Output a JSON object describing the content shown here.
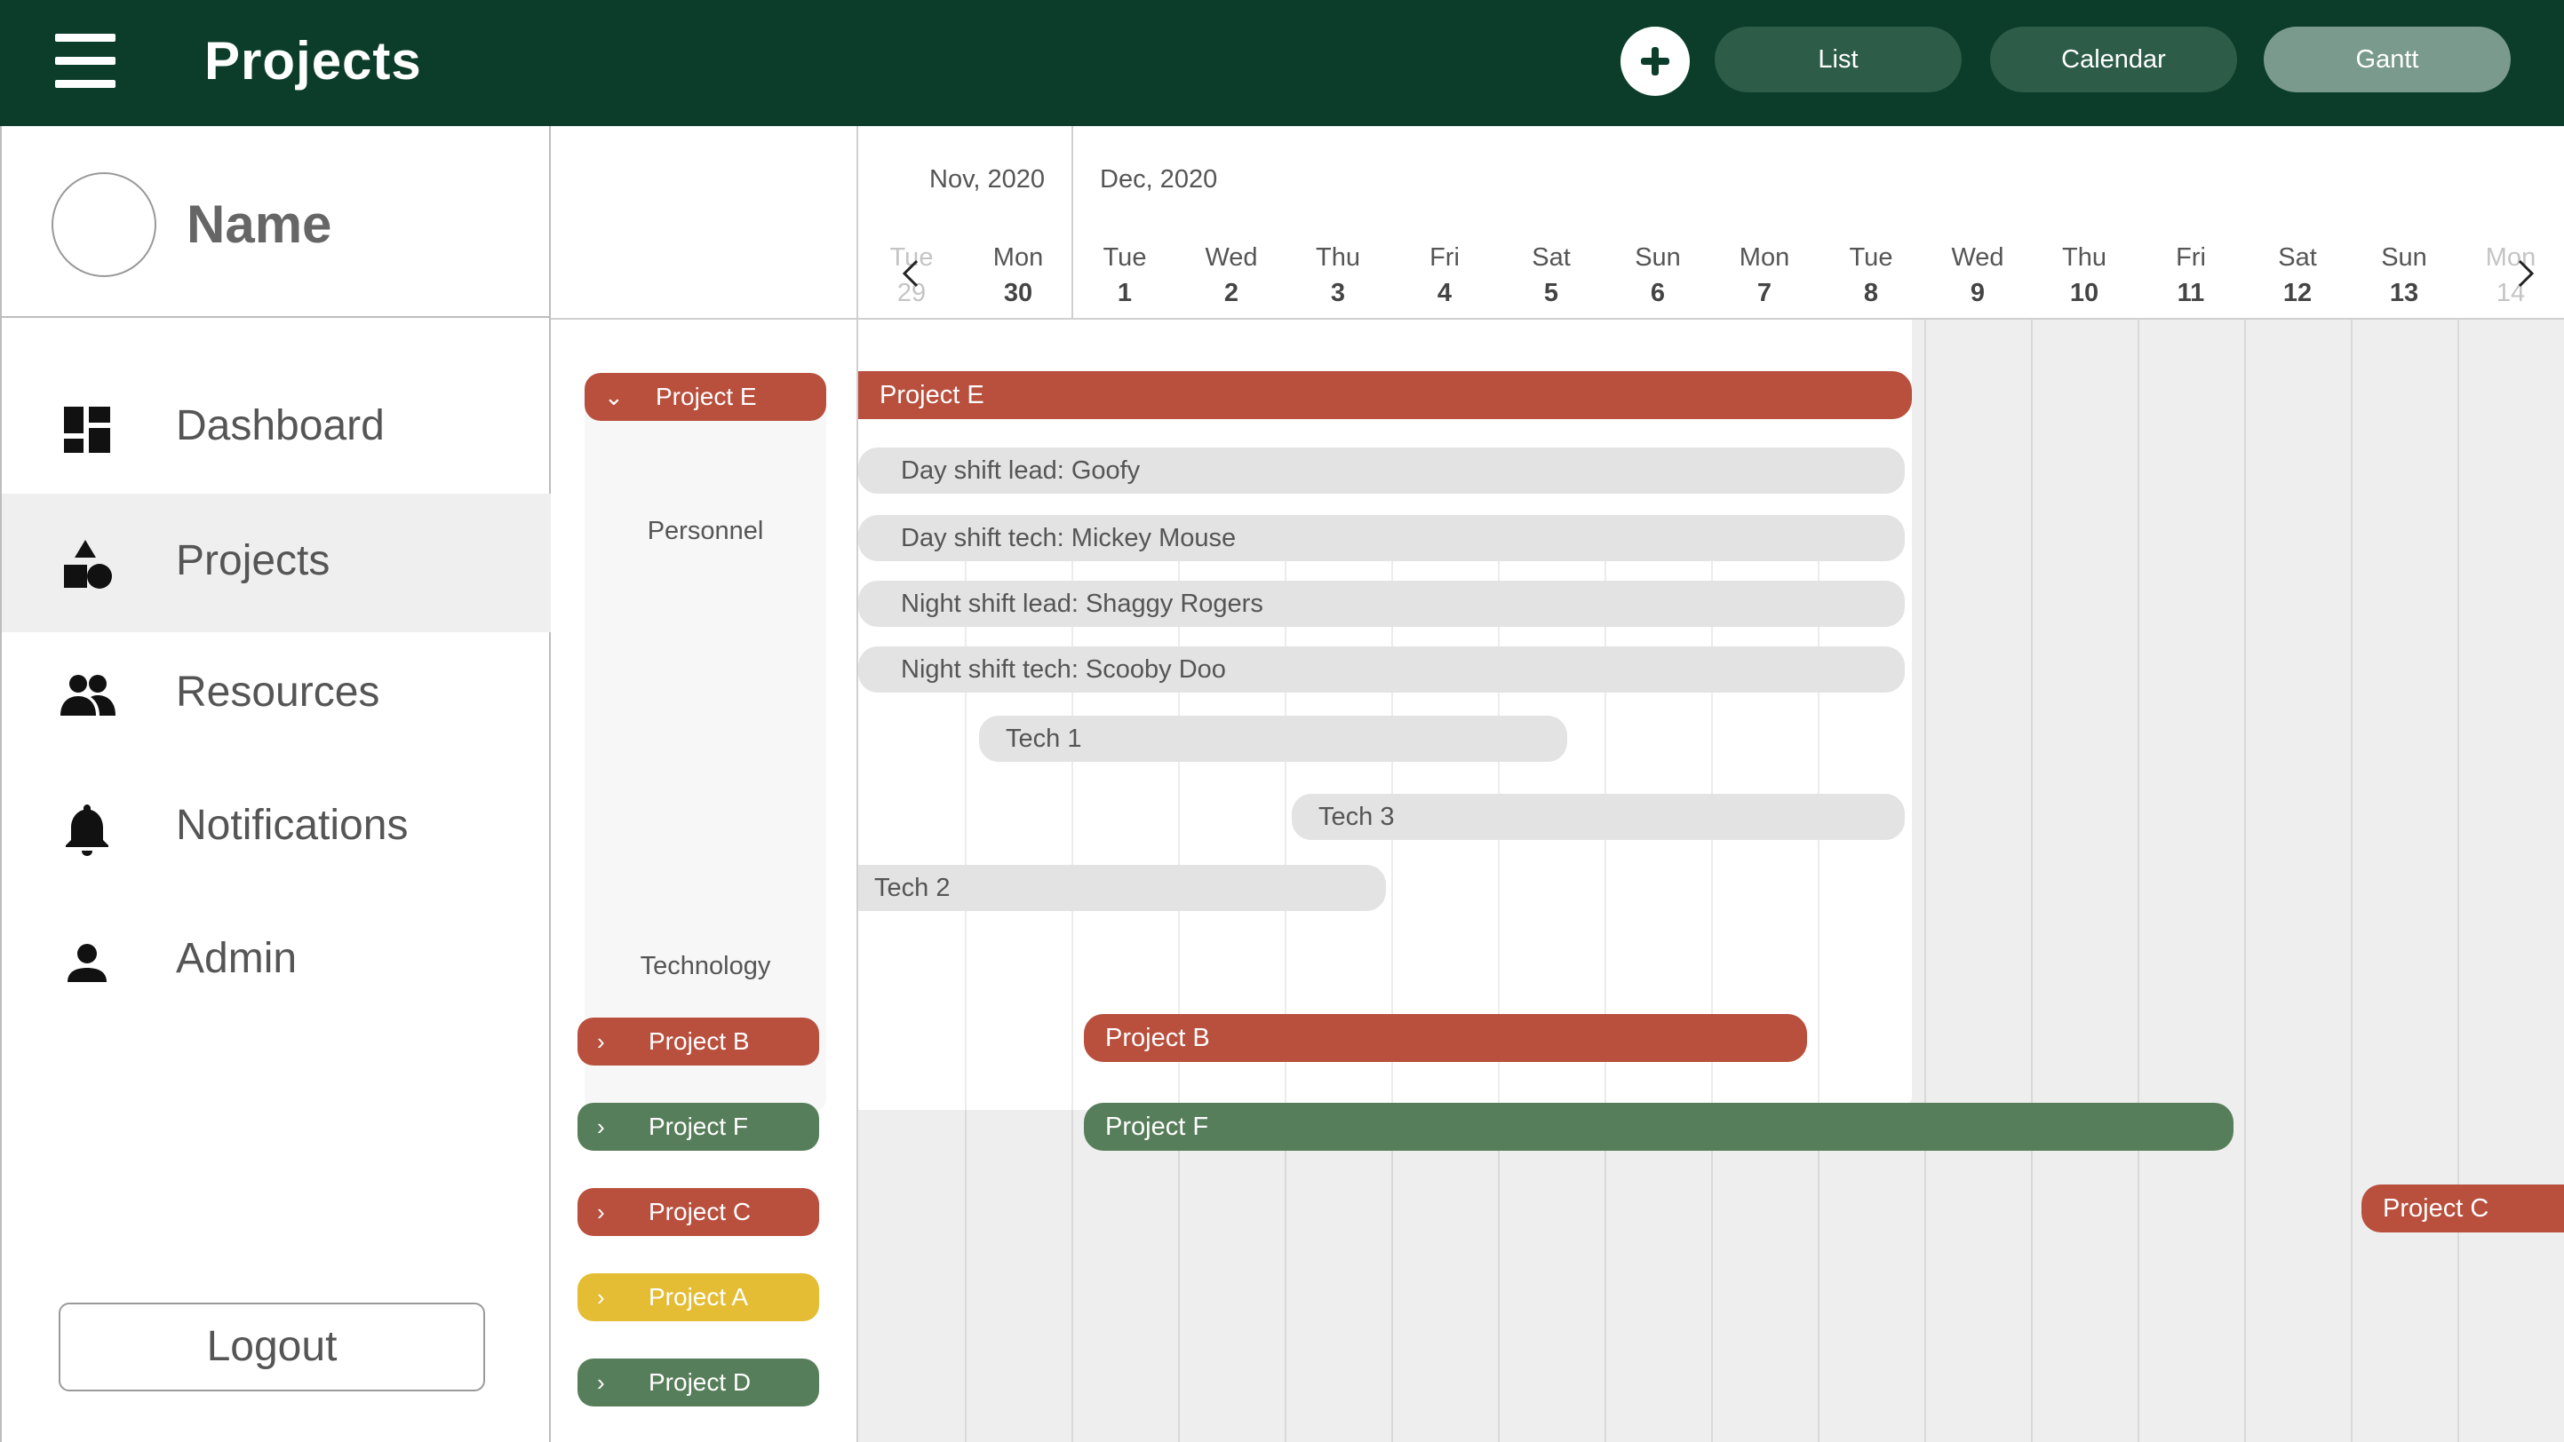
{
  "header": {
    "title": "Projects",
    "views": [
      {
        "label": "List",
        "active": false
      },
      {
        "label": "Calendar",
        "active": false
      },
      {
        "label": "Gantt",
        "active": true
      }
    ],
    "add_icon": "plus-icon",
    "menu_icon": "hamburger-menu-icon"
  },
  "profile": {
    "name": "Name"
  },
  "sidebar": {
    "items": [
      {
        "label": "Dashboard",
        "icon": "dashboard-icon",
        "active": false
      },
      {
        "label": "Projects",
        "icon": "projects-icon",
        "active": true
      },
      {
        "label": "Resources",
        "icon": "people-icon",
        "active": false
      },
      {
        "label": "Notifications",
        "icon": "bell-icon",
        "active": false
      },
      {
        "label": "Admin",
        "icon": "person-icon",
        "active": false
      }
    ],
    "logout_label": "Logout"
  },
  "colors": {
    "header_bg": "#0b3d2a",
    "red": "#b94f3d",
    "green": "#577e5a",
    "yellow": "#e5bd34",
    "active_view": "#7a9a8d"
  },
  "timeline": {
    "months": [
      "Nov, 2020",
      "Dec, 2020"
    ],
    "days": [
      {
        "dow": "Tue",
        "num": "29"
      },
      {
        "dow": "Mon",
        "num": "30"
      },
      {
        "dow": "Tue",
        "num": "1"
      },
      {
        "dow": "Wed",
        "num": "2"
      },
      {
        "dow": "Thu",
        "num": "3"
      },
      {
        "dow": "Fri",
        "num": "4"
      },
      {
        "dow": "Sat",
        "num": "5"
      },
      {
        "dow": "Sun",
        "num": "6"
      },
      {
        "dow": "Mon",
        "num": "7"
      },
      {
        "dow": "Tue",
        "num": "8"
      },
      {
        "dow": "Wed",
        "num": "9"
      },
      {
        "dow": "Thu",
        "num": "10"
      },
      {
        "dow": "Fri",
        "num": "11"
      },
      {
        "dow": "Sat",
        "num": "12"
      },
      {
        "dow": "Sun",
        "num": "13"
      },
      {
        "dow": "Mon",
        "num": "14"
      }
    ]
  },
  "projects": {
    "expanded": {
      "name": "Project E",
      "color": "red",
      "groups": [
        "Personnel",
        "Technology"
      ],
      "tasks": [
        "Day shift lead: Goofy",
        "Day shift tech: Mickey Mouse",
        "Night shift lead: Shaggy Rogers",
        "Night shift tech: Scooby Doo",
        "Tech 1",
        "Tech 3",
        "Tech 2"
      ]
    },
    "collapsed": [
      {
        "name": "Project B",
        "color": "red"
      },
      {
        "name": "Project F",
        "color": "green"
      },
      {
        "name": "Project C",
        "color": "red"
      },
      {
        "name": "Project A",
        "color": "yellow"
      },
      {
        "name": "Project D",
        "color": "green"
      }
    ]
  },
  "bars": {
    "project_e": "Project E",
    "project_b": "Project B",
    "project_f": "Project F",
    "project_c": "Project C"
  }
}
